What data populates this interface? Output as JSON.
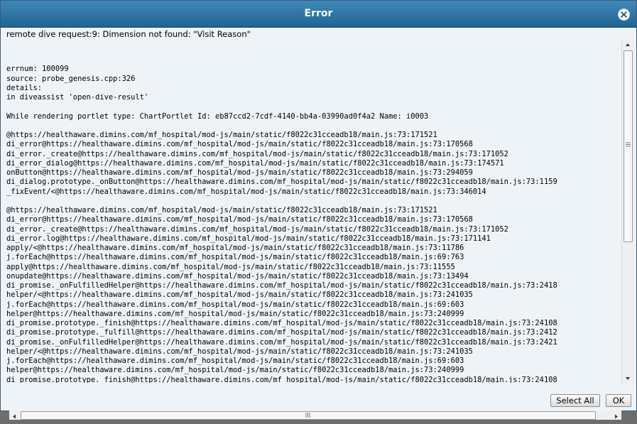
{
  "dialog": {
    "title": "Error",
    "close_icon": "close-circle-icon"
  },
  "message": {
    "summary": "remote dive request:9: Dimension not found: \"Visit Reason\"",
    "lines": [
      "",
      "errnum: 100099",
      "source: probe_genesis.cpp:326",
      "details:",
      "in diveassist 'open-dive-result'",
      "",
      "While rendering portlet type: ChartPortlet Id: eb87ccd2-7cdf-4140-bb4a-03990ad0f4a2 Name: i0003",
      "",
      "@https://healthaware.dimins.com/mf_hospital/mod-js/main/static/f8022c31cceadb18/main.js:73:171521",
      "di_error@https://healthaware.dimins.com/mf_hospital/mod-js/main/static/f8022c31cceadb18/main.js:73:170568",
      "di_error._create@https://healthaware.dimins.com/mf_hospital/mod-js/main/static/f8022c31cceadb18/main.js:73:171052",
      "di_error_dialog@https://healthaware.dimins.com/mf_hospital/mod-js/main/static/f8022c31cceadb18/main.js:73:174571",
      "onButton@https://healthaware.dimins.com/mf_hospital/mod-js/main/static/f8022c31cceadb18/main.js:73:294059",
      "di_dialog.prototype._onButton@https://healthaware.dimins.com/mf_hospital/mod-js/main/static/f8022c31cceadb18/main.js:73:1159",
      "_fixEvent/<@https://healthaware.dimins.com/mf_hospital/mod-js/main/static/f8022c31cceadb18/main.js:73:346014",
      "",
      "@https://healthaware.dimins.com/mf_hospital/mod-js/main/static/f8022c31cceadb18/main.js:73:171521",
      "di_error@https://healthaware.dimins.com/mf_hospital/mod-js/main/static/f8022c31cceadb18/main.js:73:170568",
      "di_error._create@https://healthaware.dimins.com/mf_hospital/mod-js/main/static/f8022c31cceadb18/main.js:73:171052",
      "di_error.log@https://healthaware.dimins.com/mf_hospital/mod-js/main/static/f8022c31cceadb18/main.js:73:171141",
      "apply/<@https://healthaware.dimins.com/mf_hospital/mod-js/main/static/f8022c31cceadb18/main.js:73:11786",
      "j.forEach@https://healthaware.dimins.com/mf_hospital/mod-js/main/static/f8022c31cceadb18/main.js:69:763",
      "apply@https://healthaware.dimins.com/mf_hospital/mod-js/main/static/f8022c31cceadb18/main.js:73:11555",
      "onupdate@https://healthaware.dimins.com/mf_hospital/mod-js/main/static/f8022c31cceadb18/main.js:73:13494",
      "di_promise._onFulfilledHelper@https://healthaware.dimins.com/mf_hospital/mod-js/main/static/f8022c31cceadb18/main.js:73:2418",
      "helper/<@https://healthaware.dimins.com/mf_hospital/mod-js/main/static/f8022c31cceadb18/main.js:73:241035",
      "j.forEach@https://healthaware.dimins.com/mf_hospital/mod-js/main/static/f8022c31cceadb18/main.js:69:603",
      "helper@https://healthaware.dimins.com/mf_hospital/mod-js/main/static/f8022c31cceadb18/main.js:73:240999",
      "di_promise.prototype._finish@https://healthaware.dimins.com/mf_hospital/mod-js/main/static/f8022c31cceadb18/main.js:73:24108",
      "di_promise.prototype._fulfill@https://healthaware.dimins.com/mf_hospital/mod-js/main/static/f8022c31cceadb18/main.js:73:2412",
      "di_promise._onFulfilledHelper@https://healthaware.dimins.com/mf_hospital/mod-js/main/static/f8022c31cceadb18/main.js:73:2421",
      "helper/<@https://healthaware.dimins.com/mf_hospital/mod-js/main/static/f8022c31cceadb18/main.js:73:241035",
      "j.forEach@https://healthaware.dimins.com/mf_hospital/mod-js/main/static/f8022c31cceadb18/main.js:69:603",
      "helper@https://healthaware.dimins.com/mf_hospital/mod-js/main/static/f8022c31cceadb18/main.js:73:240999",
      "di_promise.prototype._finish@https://healthaware.dimins.com/mf_hospital/mod-js/main/static/f8022c31cceadb18/main.js:73:24108"
    ]
  },
  "buttons": {
    "select_all": "Select All",
    "ok": "OK"
  }
}
